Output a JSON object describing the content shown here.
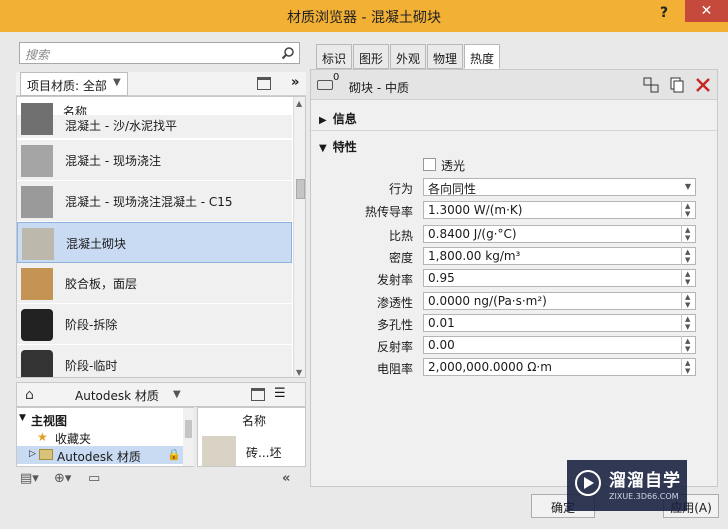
{
  "window": {
    "title": "材质浏览器 - 混凝土砌块",
    "help": "?",
    "close": "✕"
  },
  "search": {
    "placeholder": "搜索"
  },
  "project": {
    "label": "项目材质: 全部"
  },
  "list": {
    "header": "名称",
    "items": [
      {
        "label": "混凝土 - 沙/水泥找平",
        "swatch": "#7a7a7a"
      },
      {
        "label": "混凝土 - 现场浇注",
        "swatch": "#a5a5a5"
      },
      {
        "label": "混凝土 - 现场浇注混凝土 - C15",
        "swatch": "#9a9a9a"
      },
      {
        "label": "混凝土砌块",
        "swatch": "#bcb8ab"
      },
      {
        "label": "胶合板，面层",
        "swatch": "#c59455"
      },
      {
        "label": "阶段-拆除",
        "swatch": "#222222"
      },
      {
        "label": "阶段-临时",
        "swatch": "#333333"
      }
    ]
  },
  "library": {
    "crumb": "Autodesk 材质",
    "tree": [
      {
        "label": "主视图"
      },
      {
        "label": "收藏夹"
      },
      {
        "label": "Autodesk 材质"
      }
    ],
    "thumb_header": "名称",
    "thumb_caption": "砖...坯"
  },
  "tabs": [
    "标识",
    "图形",
    "外观",
    "物理",
    "热度"
  ],
  "asset": {
    "count": "0",
    "name": "砌块 - 中质"
  },
  "sections": {
    "info": "信息",
    "props": "特性"
  },
  "properties": {
    "translucent": "透光",
    "rows": [
      {
        "label": "行为",
        "value": "各向同性",
        "type": "select"
      },
      {
        "label": "热传导率",
        "value": "1.3000 W/(m·K)",
        "type": "spin"
      },
      {
        "label": "比热",
        "value": "0.8400 J/(g·°C)",
        "type": "spin"
      },
      {
        "label": "密度",
        "value": "1,800.00 kg/m³",
        "type": "spin"
      },
      {
        "label": "发射率",
        "value": "0.95",
        "type": "spin"
      },
      {
        "label": "渗透性",
        "value": "0.0000 ng/(Pa·s·m²)",
        "type": "spin"
      },
      {
        "label": "多孔性",
        "value": "0.01",
        "type": "spin"
      },
      {
        "label": "反射率",
        "value": "0.00",
        "type": "spin"
      },
      {
        "label": "电阻率",
        "value": "2,000,000.0000 Ω·m",
        "type": "spin"
      }
    ]
  },
  "buttons": {
    "ok": "确定",
    "apply": "应用(A)"
  },
  "watermark": {
    "title": "溜溜自学",
    "sub": "ZIXUE.3D66.COM"
  },
  "colors": {
    "titlebar": "#f2b035",
    "close": "#c64a3c",
    "selection": "#c9dbf2"
  }
}
